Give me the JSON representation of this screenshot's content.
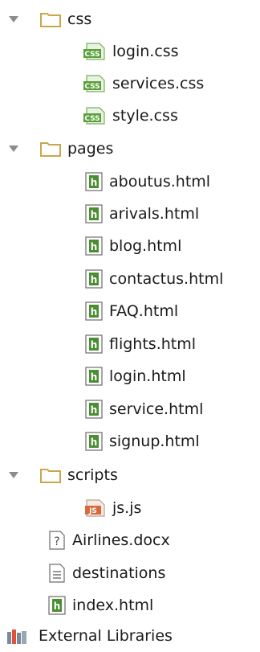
{
  "tree": {
    "css_folder": {
      "label": "css",
      "icon": "folder-icon",
      "expanded": true,
      "children": [
        "login.css",
        "services.css",
        "style.css"
      ]
    },
    "pages_folder": {
      "label": "pages",
      "icon": "folder-icon",
      "expanded": true,
      "children": [
        "aboutus.html",
        "arivals.html",
        "blog.html",
        "contactus.html",
        "FAQ.html",
        "flights.html",
        "login.html",
        "service.html",
        "signup.html"
      ]
    },
    "scripts_folder": {
      "label": "scripts",
      "icon": "folder-icon",
      "expanded": true,
      "children": [
        "js.js"
      ]
    },
    "root_files": [
      "Airlines.docx",
      "destinations",
      "index.html"
    ],
    "external_libraries": "External Libraries"
  },
  "icons": {
    "css_file": "css-file-icon",
    "html_file": "html-file-icon",
    "js_file": "js-file-icon",
    "unknown_file": "unknown-file-icon",
    "text_file": "text-file-icon",
    "library": "library-icon",
    "expand": "expand-arrow-icon"
  },
  "badges": {
    "css": "CSS",
    "html": "h",
    "js": "JS",
    "unknown": "?"
  },
  "colors": {
    "folder": "#c9a84c",
    "css_badge": "#5aa03c",
    "html_badge": "#4b8e31",
    "js_badge": "#d9683a",
    "arrow": "#8c8c8c",
    "text": "#1a1a1a"
  }
}
